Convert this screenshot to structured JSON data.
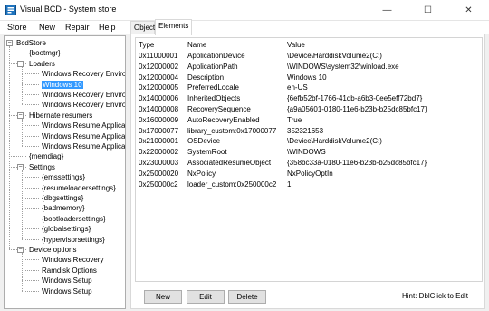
{
  "window": {
    "title": "Visual BCD - System store",
    "minimize_glyph": "—",
    "maximize_glyph": "☐",
    "close_glyph": "✕"
  },
  "menu": [
    "Store",
    "New",
    "Repair",
    "Help"
  ],
  "tree": {
    "items": [
      {
        "label": "BcdStore",
        "level": 0,
        "expander": "−"
      },
      {
        "label": "{bootmgr}",
        "level": 1
      },
      {
        "label": "Loaders",
        "level": 1,
        "expander": "−"
      },
      {
        "label": "Windows Recovery Environment",
        "level": 2
      },
      {
        "label": "Windows 10",
        "level": 2,
        "selected": true
      },
      {
        "label": "Windows Recovery Environment",
        "level": 2
      },
      {
        "label": "Windows Recovery Environment",
        "level": 2
      },
      {
        "label": "Hibernate resumers",
        "level": 1,
        "expander": "−"
      },
      {
        "label": "Windows Resume Application",
        "level": 2
      },
      {
        "label": "Windows Resume Application",
        "level": 2
      },
      {
        "label": "Windows Resume Application",
        "level": 2
      },
      {
        "label": "{memdiag}",
        "level": 1
      },
      {
        "label": "Settings",
        "level": 1,
        "expander": "−"
      },
      {
        "label": "{emssettings}",
        "level": 2
      },
      {
        "label": "{resumeloadersettings}",
        "level": 2
      },
      {
        "label": "{dbgsettings}",
        "level": 2
      },
      {
        "label": "{badmemory}",
        "level": 2
      },
      {
        "label": "{bootloadersettings}",
        "level": 2
      },
      {
        "label": "{globalsettings}",
        "level": 2
      },
      {
        "label": "{hypervisorsettings}",
        "level": 2
      },
      {
        "label": "Device options",
        "level": 1,
        "expander": "−"
      },
      {
        "label": "Windows Recovery",
        "level": 2
      },
      {
        "label": "Ramdisk Options",
        "level": 2
      },
      {
        "label": "Windows Setup",
        "level": 2
      },
      {
        "label": "Windows Setup",
        "level": 2
      }
    ]
  },
  "tabs": [
    "Object",
    "Elements"
  ],
  "active_tab": "Elements",
  "grid": {
    "columns": [
      "Type",
      "Name",
      "Value"
    ],
    "rows": [
      [
        "0x11000001",
        "ApplicationDevice",
        "\\Device\\HarddiskVolume2(C:)"
      ],
      [
        "0x12000002",
        "ApplicationPath",
        "\\WINDOWS\\system32\\winload.exe"
      ],
      [
        "0x12000004",
        "Description",
        "Windows 10"
      ],
      [
        "0x12000005",
        "PreferredLocale",
        "en-US"
      ],
      [
        "0x14000006",
        "InheritedObjects",
        "{6efb52bf-1766-41db-a6b3-0ee5eff72bd7}"
      ],
      [
        "0x14000008",
        "RecoverySequence",
        "{a9a05601-0180-11e6-b23b-b25dc85bfc17}"
      ],
      [
        "0x16000009",
        "AutoRecoveryEnabled",
        "True"
      ],
      [
        "0x17000077",
        "library_custom:0x17000077",
        "352321653"
      ],
      [
        "0x21000001",
        "OSDevice",
        "\\Device\\HarddiskVolume2(C:)"
      ],
      [
        "0x22000002",
        "SystemRoot",
        "\\WINDOWS"
      ],
      [
        "0x23000003",
        "AssociatedResumeObject",
        "{358bc33a-0180-11e6-b23b-b25dc85bfc17}"
      ],
      [
        "0x25000020",
        "NxPolicy",
        "NxPolicyOptIn"
      ],
      [
        "0x250000c2",
        "loader_custom:0x250000c2",
        "1"
      ]
    ]
  },
  "buttons": {
    "new": "New",
    "edit": "Edit",
    "delete": "Delete"
  },
  "hint": "Hint: DblClick to Edit",
  "colors": {
    "selection": "#3399ff",
    "icon": "#1e73be"
  }
}
